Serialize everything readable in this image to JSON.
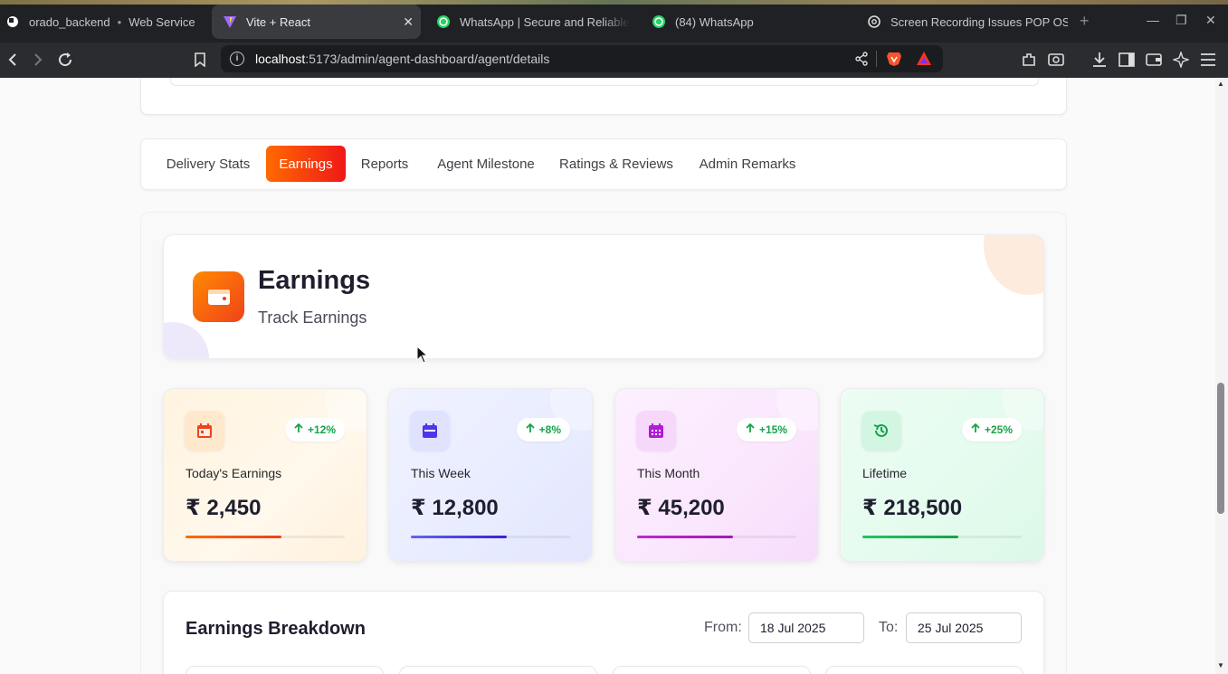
{
  "browser": {
    "tabs": [
      {
        "title": "orado_backend",
        "sub": "Web Service"
      },
      {
        "title": "Vite + React"
      },
      {
        "title": "WhatsApp | Secure and Reliable"
      },
      {
        "title": "(84) WhatsApp"
      },
      {
        "title": "Screen Recording Issues POP OS"
      }
    ],
    "close_tab_glyph": "✕",
    "new_tab_glyph": "+",
    "url_host": "localhost",
    "url_path": ":5173/admin/agent-dashboard/agent/details"
  },
  "page_tabs": [
    "Delivery Stats",
    "Earnings",
    "Reports",
    "Agent Milestone",
    "Ratings & Reviews",
    "Admin Remarks"
  ],
  "header": {
    "title": "Earnings",
    "subtitle": "Track Earnings",
    "icon": "wallet-icon"
  },
  "stats": [
    {
      "label": "Today's Earnings",
      "value": "₹ 2,450",
      "change": "+12%",
      "icon": "calendar-day-icon",
      "color": "#ff6a00",
      "progress": 0.6
    },
    {
      "label": "This Week",
      "value": "₹ 12,800",
      "change": "+8%",
      "icon": "calendar-week-icon",
      "color": "#4f46e5",
      "progress": 0.6
    },
    {
      "label": "This Month",
      "value": "₹ 45,200",
      "change": "+15%",
      "icon": "calendar-month-icon",
      "color": "#c026d3",
      "progress": 0.6
    },
    {
      "label": "Lifetime",
      "value": "₹ 218,500",
      "change": "+25%",
      "icon": "history-icon",
      "color": "#16a34a",
      "progress": 0.6
    }
  ],
  "breakdown": {
    "title": "Earnings Breakdown",
    "from_label": "From:",
    "from_value": "18 Jul 2025",
    "to_label": "To:",
    "to_value": "25 Jul 2025"
  }
}
